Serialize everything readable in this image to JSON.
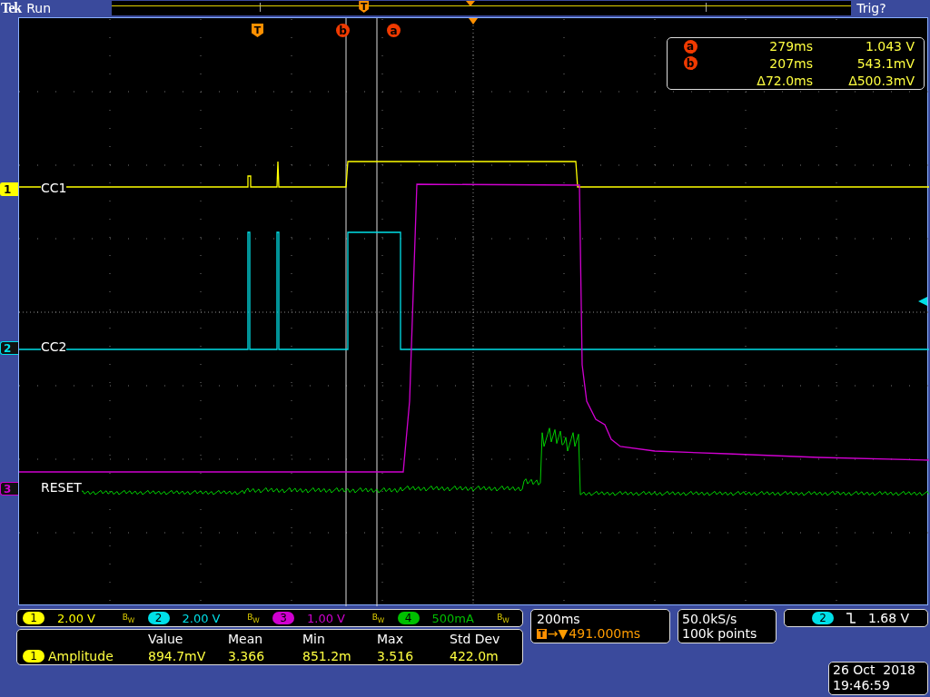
{
  "status_bar": {
    "brand": "Tek",
    "state": "Run",
    "trigger_status": "Trig?"
  },
  "record_view": {
    "trigger_marker": "T"
  },
  "cursor_markers": [
    {
      "label": "T",
      "kind": "trigger"
    },
    {
      "label": "b",
      "kind": "cursor"
    },
    {
      "label": "a",
      "kind": "cursor"
    }
  ],
  "cursor_readout": [
    {
      "marker": "a",
      "time": "279ms",
      "value": "1.043 V"
    },
    {
      "marker": "b",
      "time": "207ms",
      "value": "543.1mV"
    },
    {
      "time": "Δ72.0ms",
      "value": "Δ500.3mV"
    }
  ],
  "channels": [
    {
      "number": "1",
      "label": "CC1",
      "color": "#ffff00",
      "selected": true
    },
    {
      "number": "2",
      "label": "CC2",
      "color": "#00e0e8",
      "selected": false
    },
    {
      "number": "3",
      "label": "RESET",
      "color": "#d000d0",
      "selected": false
    }
  ],
  "scales": [
    {
      "number": "1",
      "value": "2.00 V",
      "bw": "B$_{W}$",
      "color": "#ffff00"
    },
    {
      "number": "2",
      "value": "2.00 V",
      "bw": "B$_{W}$",
      "color": "#00e0e8"
    },
    {
      "number": "3",
      "value": "1.00 V",
      "bw": "B$_{W}$",
      "color": "#d000d0"
    },
    {
      "number": "4",
      "value": "500mA",
      "bw": "B$_{W}$",
      "color": "#00c000"
    }
  ],
  "measurement": {
    "channel": "1",
    "name": "Amplitude",
    "columns": [
      "Value",
      "Mean",
      "Min",
      "Max",
      "Std Dev"
    ],
    "values": [
      "894.7mV",
      "3.366",
      "851.2m",
      "3.516",
      "422.0m"
    ]
  },
  "timebase": {
    "scale": "200ms",
    "marker": "T",
    "arrows": "→▼",
    "position": "491.000ms"
  },
  "acquisition": {
    "sample_rate": "50.0kS/s",
    "record_length": "100k points"
  },
  "trigger": {
    "channel": "2",
    "level": "1.68 V"
  },
  "datetime": {
    "date": "26 Oct  2018",
    "time": "19:46:59"
  }
}
